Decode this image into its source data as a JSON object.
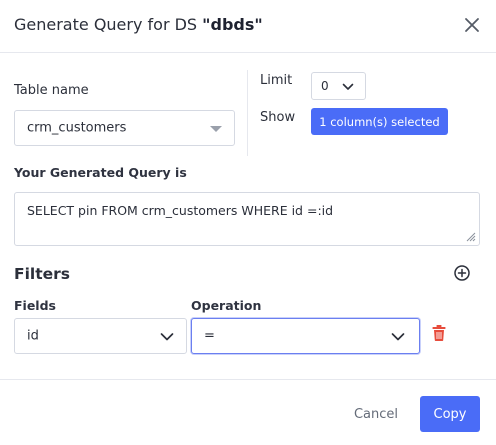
{
  "dialog": {
    "title_prefix": "Generate Query for DS ",
    "title_ds": "\"dbds\""
  },
  "table": {
    "label": "Table name",
    "value": "crm_customers"
  },
  "limit": {
    "label": "Limit",
    "value": "0"
  },
  "show": {
    "label": "Show",
    "button_label": "1 column(s) selected"
  },
  "query": {
    "label": "Your Generated Query is",
    "value": "SELECT pin FROM crm_customers WHERE id =:id"
  },
  "filters": {
    "title": "Filters",
    "fields_label": "Fields",
    "operation_label": "Operation",
    "rows": [
      {
        "field": "id",
        "operation": "="
      }
    ]
  },
  "footer": {
    "cancel_label": "Cancel",
    "copy_label": "Copy"
  },
  "colors": {
    "primary": "#4a6cf7",
    "danger": "#e74c3c",
    "border": "#d5d9e2",
    "focus_border": "#6b7ff0"
  },
  "icons": {
    "close": "close-icon",
    "add": "plus-circle-icon",
    "delete": "trash-icon",
    "dropdown": "chevron-down-icon"
  }
}
